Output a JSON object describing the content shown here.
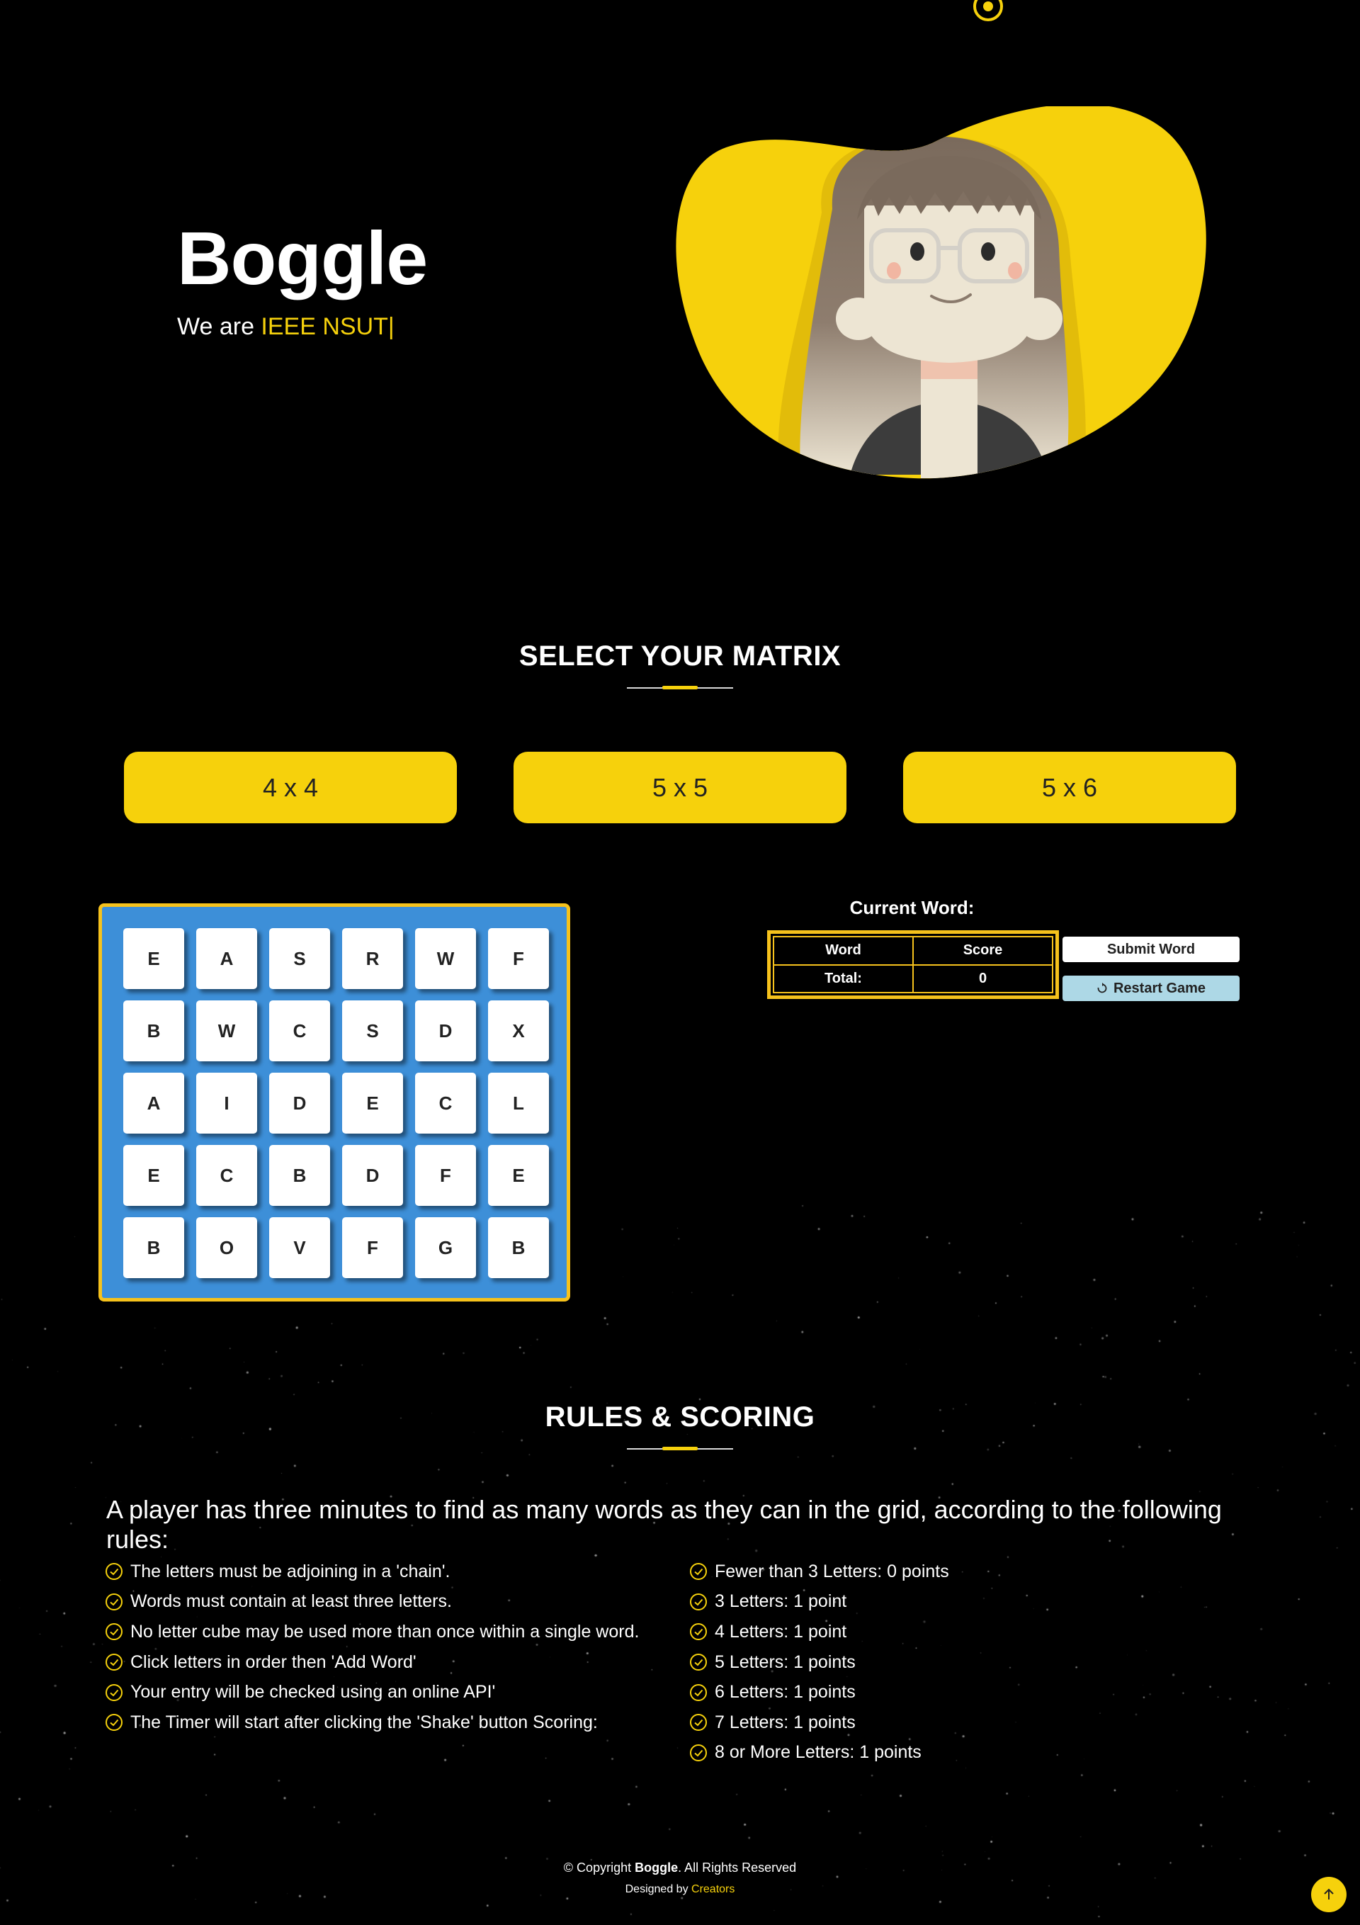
{
  "hero": {
    "title": "Boggle",
    "subtitle_prefix": "We are ",
    "subtitle_highlight": "IEEE NSUT",
    "cursor": "|"
  },
  "matrix_section": {
    "title": "SELECT YOUR MATRIX",
    "options": [
      "4 x 4",
      "5 x 5",
      "5 x 6"
    ]
  },
  "board": {
    "rows": [
      [
        "E",
        "A",
        "S",
        "R",
        "W",
        "F"
      ],
      [
        "B",
        "W",
        "C",
        "S",
        "D",
        "X"
      ],
      [
        "A",
        "I",
        "D",
        "E",
        "C",
        "L"
      ],
      [
        "E",
        "C",
        "B",
        "D",
        "F",
        "E"
      ],
      [
        "B",
        "O",
        "V",
        "F",
        "G",
        "B"
      ]
    ]
  },
  "game": {
    "current_word_label": "Current Word:",
    "table": {
      "header": [
        "Word",
        "Score"
      ],
      "total_label": "Total:",
      "total_value": "0"
    },
    "submit_label": "Submit Word",
    "restart_label": "Restart Game"
  },
  "rules_section": {
    "title": "RULES & SCORING",
    "intro": "A player has three minutes to find as many words as they can in the grid, according to the following rules:",
    "rules": [
      "The letters must be adjoining in a 'chain'.",
      "Words must contain at least three letters.",
      "No letter cube may be used more than once within a single word.",
      "Click letters in order then 'Add Word'",
      "Your entry will be checked using an online API'",
      "The Timer will start after clicking the 'Shake' button Scoring:"
    ],
    "scoring": [
      "Fewer than 3 Letters: 0 points",
      "3 Letters: 1 point",
      "4 Letters: 1 point",
      "5 Letters: 1 points",
      "6 Letters: 1 points",
      "7 Letters: 1 points",
      "8 or More Letters: 1 points"
    ]
  },
  "footer": {
    "copyright_prefix": "© Copyright ",
    "brand": "Boggle",
    "copyright_suffix": ". All Rights Reserved",
    "designed_prefix": "Designed by ",
    "designer": "Creators"
  },
  "colors": {
    "accent": "#f6d10c",
    "board": "#3d8fd8",
    "restart": "#add8e6",
    "background": "#000000"
  },
  "icons": [
    "check-circle-icon",
    "restart-icon",
    "arrow-up-icon",
    "scroll-indicator-icon"
  ]
}
